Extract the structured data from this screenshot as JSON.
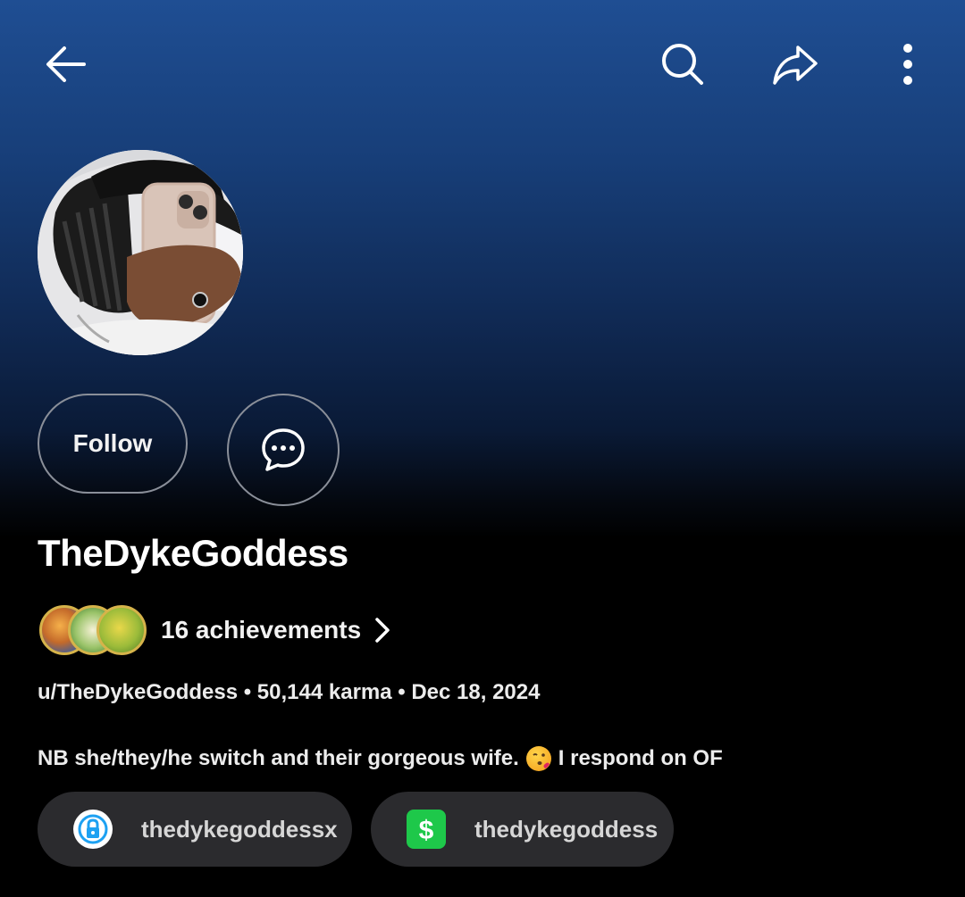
{
  "header": {
    "back_icon": "arrow-left-icon",
    "search_icon": "search-icon",
    "share_icon": "share-icon",
    "more_icon": "more-vertical-icon",
    "gradient_top": "#1f4e93"
  },
  "profile": {
    "avatar_icon": "avatar-photo",
    "follow_label": "Follow",
    "chat_icon": "chat-bubble-icon",
    "display_name": "TheDykeGoddess",
    "achievements_label": "16 achievements",
    "meta_line": "u/TheDykeGoddess • 50,144 karma • Dec 18, 2024",
    "bio_before": "NB she/they/he switch and their gorgeous wife.",
    "bio_emoji": "face-blowing-kiss-emoji",
    "bio_after": "I respond on OF"
  },
  "links": [
    {
      "icon": "lock-icon",
      "label": "thedykegoddessx",
      "icon_color": "#ffffff"
    },
    {
      "icon": "cash-app-icon",
      "label": "thedykegoddess",
      "icon_color": "#1ec84a"
    }
  ]
}
